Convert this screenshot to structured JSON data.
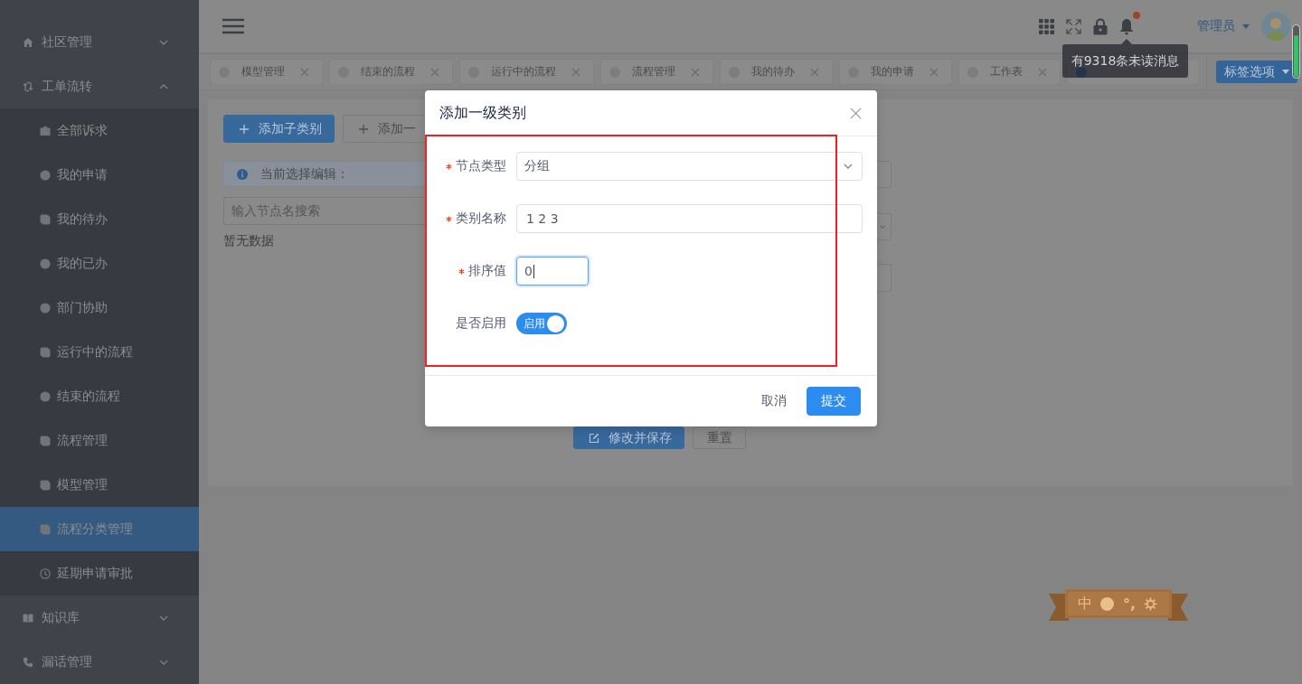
{
  "sidebar": {
    "items": [
      {
        "label": "社区管理",
        "expanded": false
      },
      {
        "label": "工单流转",
        "expanded": true,
        "children": [
          {
            "label": "全部诉求",
            "selected": false
          },
          {
            "label": "我的申请",
            "selected": false
          },
          {
            "label": "我的待办",
            "selected": false
          },
          {
            "label": "我的已办",
            "selected": false
          },
          {
            "label": "部门协助",
            "selected": false
          },
          {
            "label": "运行中的流程",
            "selected": false
          },
          {
            "label": "结束的流程",
            "selected": false
          },
          {
            "label": "流程管理",
            "selected": false
          },
          {
            "label": "模型管理",
            "selected": false
          },
          {
            "label": "流程分类管理",
            "selected": true
          },
          {
            "label": "延期申请审批",
            "selected": false
          }
        ]
      },
      {
        "label": "知识库",
        "expanded": false
      },
      {
        "label": "漏话管理",
        "expanded": false
      }
    ]
  },
  "header": {
    "unread_badge": true,
    "notification_tooltip": "有9318条未读消息",
    "user": "管理员"
  },
  "tabs": [
    {
      "label": "模型管理",
      "selected": false
    },
    {
      "label": "结束的流程",
      "selected": false
    },
    {
      "label": "运行中的流程",
      "selected": false
    },
    {
      "label": "流程管理",
      "selected": false
    },
    {
      "label": "我的待办",
      "selected": false
    },
    {
      "label": "我的申请",
      "selected": false
    },
    {
      "label": "工作表",
      "selected": false
    },
    {
      "selected": true
    }
  ],
  "tab_options": "标签选项",
  "page": {
    "toolbar_buttons": [
      {
        "label": "添加子类别",
        "kind": "primary"
      },
      {
        "label": "添加一",
        "kind": "default"
      }
    ],
    "info": "当前选择编辑：",
    "search": {
      "placeholder": "输入节点名搜索"
    },
    "empty_text": "暂无数据",
    "form_buttons": [
      {
        "label": "修改并保存",
        "kind": "primary"
      },
      {
        "label": "重置",
        "kind": "default"
      }
    ]
  },
  "dialog": {
    "title": "添加一级类别",
    "fields": [
      {
        "kind": "select",
        "label": "节点类型",
        "required": true,
        "focused": false,
        "value": "分组"
      },
      {
        "kind": "text",
        "label": "类别名称",
        "required": true,
        "focused": false,
        "value": "1 2 3"
      },
      {
        "kind": "number",
        "label": "排序值",
        "required": true,
        "focused": true,
        "value": "0"
      },
      {
        "kind": "switch",
        "label": "是否启用",
        "required": false,
        "on": true,
        "on_text": "启用"
      }
    ],
    "buttons": [
      {
        "label": "取消",
        "kind": "text"
      },
      {
        "label": "提交",
        "kind": "primary"
      }
    ]
  },
  "ime_toolbar": {
    "mode": "中",
    "punctuation": "°,"
  }
}
